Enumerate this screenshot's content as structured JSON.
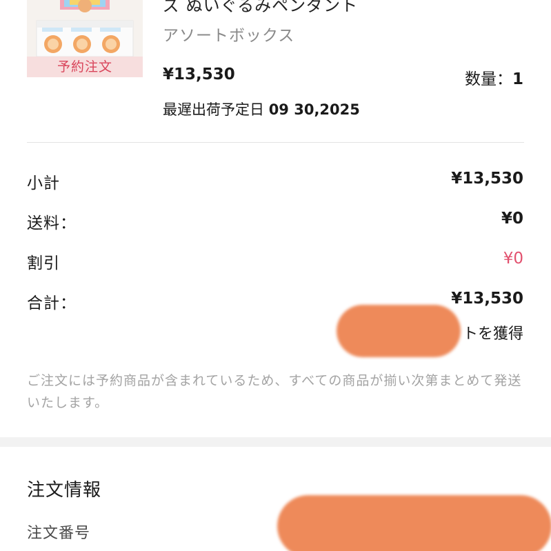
{
  "product": {
    "tag": "予約注文",
    "name": "ズ ぬいぐるみペンダント",
    "variant": "アソートボックス",
    "price": "¥13,530",
    "qty_label": "数量：",
    "qty_value": "1",
    "ship_label": "最遅出荷予定日",
    "ship_date": "09 30,2025"
  },
  "summary": {
    "subtotal_label": "小計",
    "subtotal_value": "¥13,530",
    "shipping_label": "送料：",
    "shipping_value": "¥0",
    "discount_label": "割引",
    "discount_value": "¥0",
    "total_label": "合計：",
    "total_value": "¥13,530",
    "points_text": "トを獲得"
  },
  "note": "ご注文には予約商品が含まれているため、すべての商品が揃い次第まとめて発送いたします。",
  "order_info": {
    "title": "注文情報",
    "order_number_label": "注文番号"
  },
  "colors": {
    "discount": "#e2516e",
    "tag_text": "#d9445a",
    "redaction": "#ee8a5a"
  }
}
